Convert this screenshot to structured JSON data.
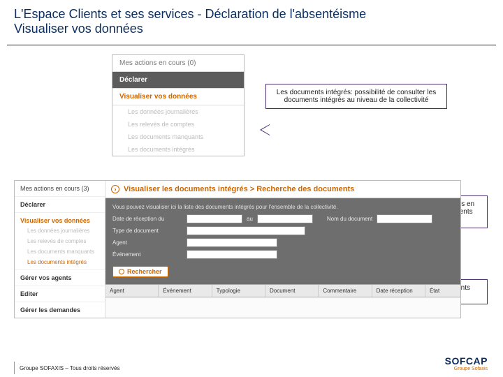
{
  "title": {
    "line1": "L'Espace Clients et ses services - Déclaration de l'absentéisme",
    "line2": "Visualiser vos données"
  },
  "menu_panel": {
    "actions": "Mes actions en cours (0)",
    "declarer": "Déclarer",
    "visualiser": "Visualiser vos données",
    "subs": [
      "Les données journalières",
      "Les relevés de comptes",
      "Les documents manquants",
      "Les documents intégrés"
    ]
  },
  "callouts": {
    "c1": "Les documents intégrés: possibilité de consulter les documents intégrés au niveau de la collectivité",
    "c2": "Compléter les filtres en fonction des éléments recherchés",
    "c3": "Consulter les documents intégrés"
  },
  "app": {
    "left": {
      "actions": "Mes actions en cours (3)",
      "declarer": "Déclarer",
      "visualiser": "Visualiser vos données",
      "subs": [
        "Les données journalières",
        "Les relevés de comptes",
        "Les documents manquants",
        "Les documents intégrés"
      ],
      "gerer_agents": "Gérer vos agents",
      "editer": "Editer",
      "gerer_demandes": "Gérer les demandes"
    },
    "right": {
      "title": "Visualiser les documents intégrés > Recherche des documents",
      "desc": "Vous pouvez visualiser ici la liste des documents intégrés pour l'ensemble de la collectivité.",
      "labels": {
        "date": "Date de réception du",
        "au": "au",
        "nom": "Nom du document",
        "type": "Type de document",
        "agent": "Agent",
        "evenement": "Événement"
      },
      "search": "Rechercher",
      "columns": [
        "Agent",
        "Événement",
        "Typologie",
        "Document",
        "Commentaire",
        "Date réception",
        "État"
      ]
    }
  },
  "footer": "Groupe SOFAXIS – Tous droits réservés",
  "logo": {
    "name": "SOFCAP",
    "sub": "Groupe Sofaxis"
  }
}
